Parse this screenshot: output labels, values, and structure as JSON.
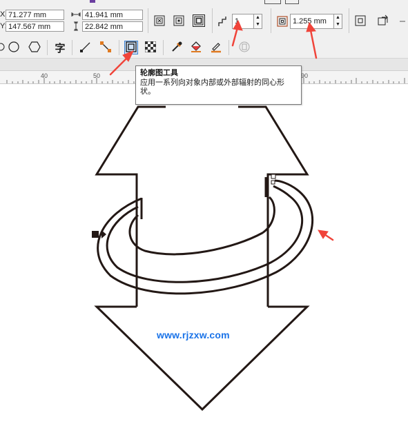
{
  "property_bar": {
    "x_label": "X:",
    "x_value": "71.277 mm",
    "y_label": "Y:",
    "y_value": "147.567 mm",
    "width_value": "41.941 mm",
    "height_value": "22.842 mm",
    "contour_steps": "1",
    "contour_offset": "1.255 mm"
  },
  "toolbox": {
    "text_tool_glyph": "字"
  },
  "ruler": {
    "ticks": [
      "40",
      "50",
      "90"
    ]
  },
  "tooltip": {
    "title": "轮廓图工具",
    "description": "应用一系列向对象内部或外部辐射的同心形状。"
  },
  "canvas": {
    "watermark": "www.rjzxw.com"
  },
  "colors": {
    "annotation_arrow": "#f0443a",
    "outline": "#231815",
    "watermark": "#1a73e8",
    "active_tool": "#cfe2f7"
  },
  "icons": [
    "to-center-icon",
    "to-inside-icon",
    "to-outside-icon",
    "steps-icon",
    "offset-icon",
    "contour-icon",
    "mesh-icon",
    "copy-icon",
    "ellipse-icon",
    "polygon-icon",
    "text-icon",
    "line-icon",
    "connector-icon",
    "contour-tool-icon",
    "transparency-icon",
    "eyedropper-icon",
    "fill-icon",
    "outline-pen-icon",
    "lock-icon"
  ]
}
